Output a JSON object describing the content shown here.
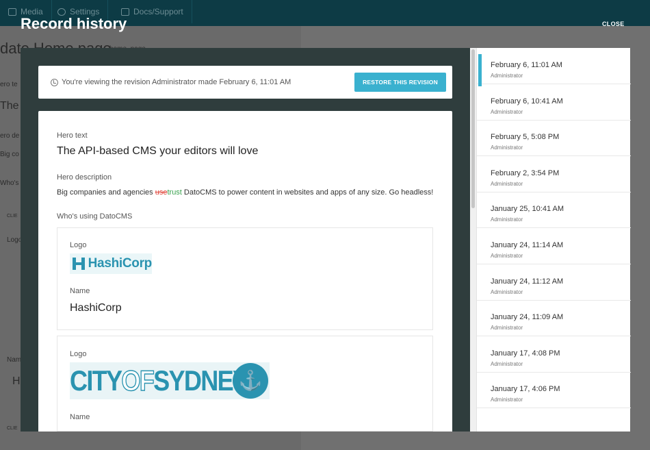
{
  "background": {
    "nav": [
      "Media",
      "Settings",
      "Docs/Support"
    ],
    "page_title": "date Home page",
    "page_chip": "home_page",
    "frags": [
      "ero te",
      "The",
      "ero de",
      "Big co",
      "Who's u",
      "CLIE",
      "Logo",
      "Nam",
      "H",
      "CLIE"
    ]
  },
  "modal": {
    "title": "Record history",
    "close_label": "CLOSE"
  },
  "notice": {
    "text": "You're viewing the revision Administrator made February 6, 11:01 AM",
    "restore_label": "RESTORE THIS REVISION"
  },
  "content": {
    "hero_text_label": "Hero text",
    "hero_text_value": "The API-based CMS your editors will love",
    "hero_desc_label": "Hero description",
    "hero_desc_before": "Big companies and agencies ",
    "hero_desc_deleted": "use",
    "hero_desc_inserted": "trust",
    "hero_desc_after": " DatoCMS to power content in websites and apps of any size. Go headless!",
    "clients_label": "Who's using DatoCMS",
    "clients": [
      {
        "logo_label": "Logo",
        "logo_text": "HashiCorp",
        "name_label": "Name",
        "name_value": "HashiCorp"
      },
      {
        "logo_label": "Logo",
        "logo_text_a": "CITY",
        "logo_text_b": "OF",
        "logo_text_c": "SYDNEY",
        "name_label": "Name"
      }
    ]
  },
  "revisions": [
    {
      "date": "February 6, 11:01 AM",
      "user": "Administrator",
      "active": true
    },
    {
      "date": "February 6, 10:41 AM",
      "user": "Administrator"
    },
    {
      "date": "February 5, 5:08 PM",
      "user": "Administrator"
    },
    {
      "date": "February 2, 3:54 PM",
      "user": "Administrator"
    },
    {
      "date": "January 25, 10:41 AM",
      "user": "Administrator"
    },
    {
      "date": "January 24, 11:14 AM",
      "user": "Administrator"
    },
    {
      "date": "January 24, 11:12 AM",
      "user": "Administrator"
    },
    {
      "date": "January 24, 11:09 AM",
      "user": "Administrator"
    },
    {
      "date": "January 17, 4:08 PM",
      "user": "Administrator"
    },
    {
      "date": "January 17, 4:06 PM",
      "user": "Administrator"
    }
  ],
  "colors": {
    "accent": "#3ab1cf",
    "topbar": "#0d3b45",
    "modal_bg": "#2f3d3d",
    "deleted": "#e0453a",
    "inserted": "#3aa24f"
  }
}
